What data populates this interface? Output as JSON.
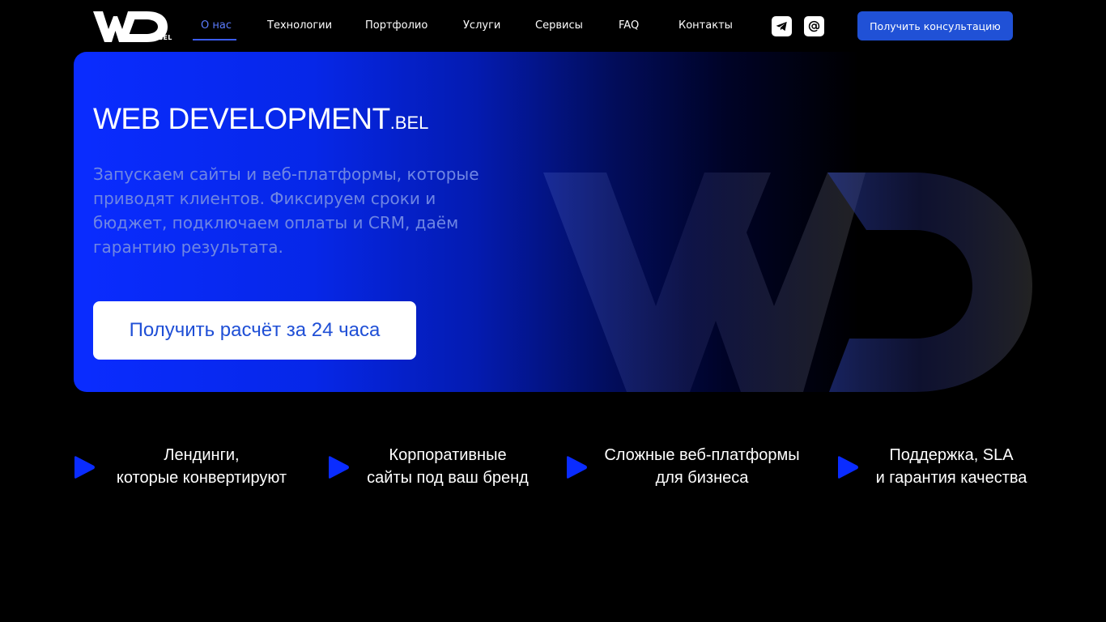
{
  "header": {
    "logo_text": "WD",
    "logo_suffix": ".BEL",
    "nav": [
      {
        "label": "О нас",
        "active": true
      },
      {
        "label": "Технологии",
        "active": false
      },
      {
        "label": "Портфолио",
        "active": false
      },
      {
        "label": "Услуги",
        "active": false
      },
      {
        "label": "Сервисы",
        "active": false
      },
      {
        "label": "FAQ",
        "active": false
      },
      {
        "label": "Контакты",
        "active": false
      }
    ],
    "social_icons": [
      "telegram-icon",
      "email-at-icon"
    ],
    "cta_label": "Получить консультацию"
  },
  "hero": {
    "title": "WEB DEVELOPMENT",
    "title_suffix": ".BEL",
    "description": "Запускаем сайты и веб-платформы, которые приводят клиентов. Фиксируем сроки и бюджет, подключаем оплаты и CRM, даём гарантию результата.",
    "cta_label": "Получить расчёт за 24 часа",
    "watermark": "WD"
  },
  "features": [
    {
      "line1": "Лендинги,",
      "line2": "которые конвертируют",
      "icon": "play-icon"
    },
    {
      "line1": "Корпоративные",
      "line2": "сайты под ваш бренд",
      "icon": "play-icon"
    },
    {
      "line1": "Сложные веб-платформы",
      "line2": "для бизнеса",
      "icon": "play-icon"
    },
    {
      "line1": "Поддержка, SLA",
      "line2": "и гарантия качества",
      "icon": "play-icon"
    }
  ],
  "colors": {
    "background": "#000000",
    "accent_blue": "#0a2cff",
    "button_blue": "#2051d6",
    "active_nav": "#5b7cff",
    "description_text": "#6f86e3"
  }
}
